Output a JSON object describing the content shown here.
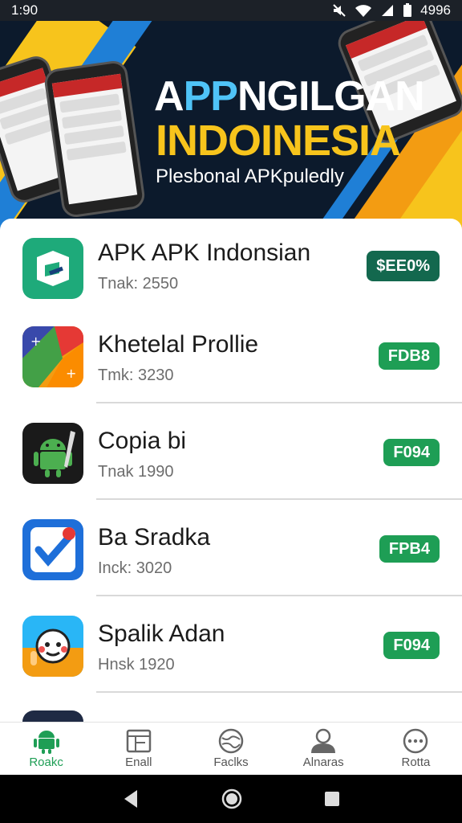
{
  "status_bar": {
    "time": "1:90",
    "battery": "4996"
  },
  "banner": {
    "title_line1_pre": "A",
    "title_line1_highlight": "PP",
    "title_line1_post": "NGILGAN",
    "title_line2": "INDOINESIA",
    "subtitle": "Plesbonal APKpuledly"
  },
  "apps": [
    {
      "name": "APK APK Indonsian",
      "meta": "Tnak: 2550",
      "badge": "$EE0%",
      "badge_color": "#13684e"
    },
    {
      "name": "Khetelal Prollie",
      "meta": "Tmk: 3230",
      "badge": "FDB8",
      "badge_color": "#1e9e55"
    },
    {
      "name": "Copia bi",
      "meta": "Tnak 1990",
      "badge": "F094",
      "badge_color": "#1e9e55"
    },
    {
      "name": "Ba Sradka",
      "meta": "Inck: 3020",
      "badge": "FPB4",
      "badge_color": "#1e9e55"
    },
    {
      "name": "Spalik Adan",
      "meta": "Hnsk 1920",
      "badge": "F094",
      "badge_color": "#1e9e55"
    }
  ],
  "bottom_nav": [
    {
      "label": "Roakc",
      "icon": "android-icon",
      "active": true
    },
    {
      "label": "Enall",
      "icon": "tablet-icon",
      "active": false
    },
    {
      "label": "Faclks",
      "icon": "globe-icon",
      "active": false
    },
    {
      "label": "Alnaras",
      "icon": "person-icon",
      "active": false
    },
    {
      "label": "Rotta",
      "icon": "more-icon",
      "active": false
    }
  ],
  "colors": {
    "accent": "#1e9e55",
    "banner_yellow": "#f7c41c",
    "banner_dark": "#0c1a2c"
  }
}
